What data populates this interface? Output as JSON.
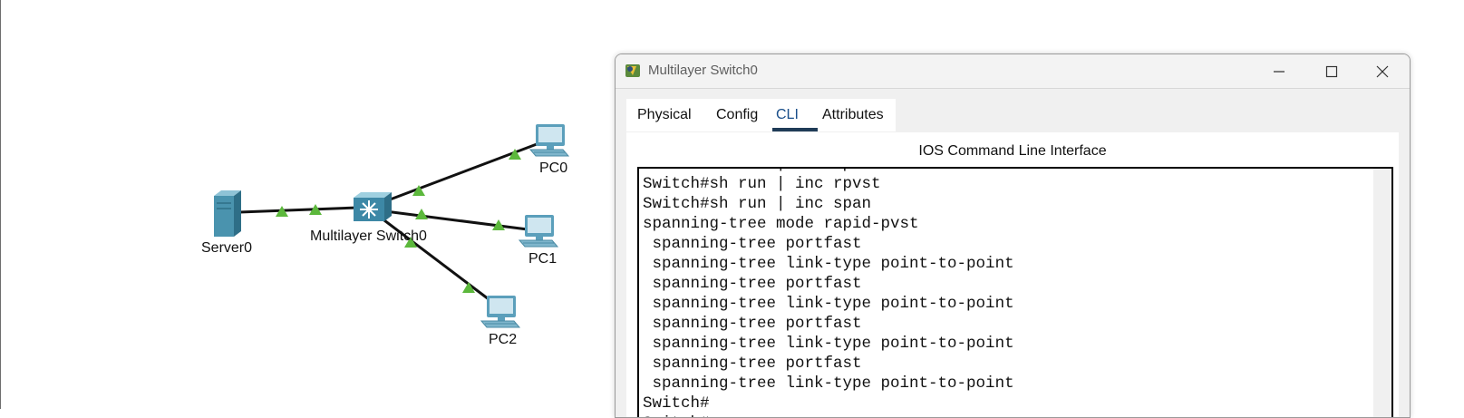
{
  "devices": {
    "server0": "Server0",
    "switch0": "Multilayer Switch0",
    "pc0": "PC0",
    "pc1": "PC1",
    "pc2": "PC2"
  },
  "window": {
    "title": "Multilayer Switch0",
    "tabs": {
      "physical": "Physical",
      "config": "Config",
      "cli": "CLI",
      "attributes": "Attributes"
    },
    "active_tab": "CLI",
    "cli_heading": "IOS Command Line Interface",
    "cli_output": "Switch#sh run | inc rp\nSwitch#sh run | inc rpvst\nSwitch#sh run | inc span\nspanning-tree mode rapid-pvst\n spanning-tree portfast\n spanning-tree link-type point-to-point\n spanning-tree portfast\n spanning-tree link-type point-to-point\n spanning-tree portfast\n spanning-tree link-type point-to-point\n spanning-tree portfast\n spanning-tree link-type point-to-point\nSwitch#\nSwitch#"
  },
  "colors": {
    "link_up": "#5cb83c",
    "active_tab_underline": "#1f3b57",
    "active_tab_text": "#1a4f8a"
  },
  "icons": [
    "server-icon",
    "multilayer-switch-icon",
    "pc-icon",
    "minimize-icon",
    "maximize-icon",
    "close-icon",
    "packet-tracer-icon"
  ]
}
